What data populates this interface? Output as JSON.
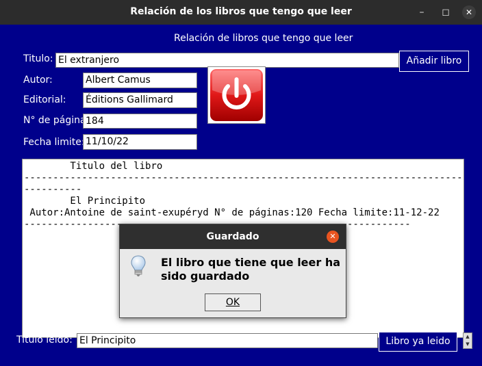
{
  "window": {
    "title": "Relación de los libros que tengo que leer"
  },
  "header": {
    "title": "Relación de libros que tengo que leer"
  },
  "form": {
    "titulo_label": "Titulo:",
    "titulo_value": "El extranjero",
    "autor_label": "Autor:",
    "autor_value": "Albert Camus",
    "editorial_label": "Editorial:",
    "editorial_value": "Éditions Gallimard",
    "paginas_label": "N° de páginas",
    "paginas_value": "184",
    "fecha_label": "Fecha limite:",
    "fecha_value": "11/10/22"
  },
  "buttons": {
    "add_book": "Añadir libro",
    "read_book": "Libro ya leido"
  },
  "list": {
    "header": "        Titulo del libro",
    "sep1": "-------------------------------------------------------------------------------",
    "sep1b": "----------",
    "blank": "",
    "book_title": "        El Principito",
    "book_details": " Autor:Antoine de saint-exupéryd N° de páginas:120 Fecha limite:11-12-22",
    "sep2": "-------------------------------------------------------------------"
  },
  "bottom": {
    "titulo_leido_label": "Titulo leido:",
    "titulo_leido_value": "El Principito"
  },
  "dialog": {
    "title": "Guardado",
    "message": "El libro que tiene que leer ha sido guardado",
    "ok": "OK"
  },
  "colors": {
    "background": "#00008b",
    "titlebar": "#2c2c2c",
    "power_red": "#e02020",
    "dialog_close": "#e95420"
  }
}
